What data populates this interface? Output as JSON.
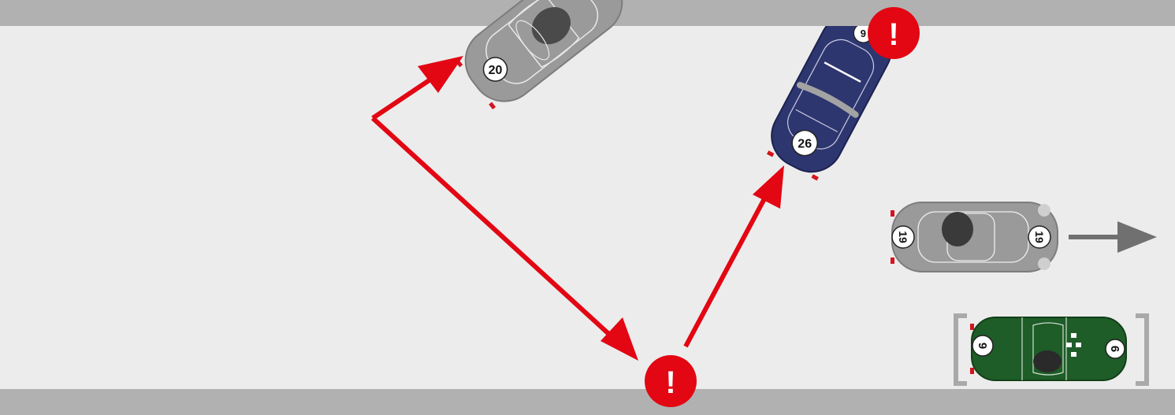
{
  "colors": {
    "track": "#ececec",
    "barrier": "#b1b1b1",
    "arrow_red": "#e30613",
    "arrow_grey": "#707070",
    "bracket": "#a9a9a9",
    "car_grey": "#9a9a9a",
    "car_grey_dark": "#4a4a4a",
    "car_blue": "#2e3670",
    "car_green": "#1e5c28",
    "lamp_red": "#d4141e"
  },
  "cars": [
    {
      "id": "car-20",
      "number": "20",
      "color": "grey",
      "flagged": false
    },
    {
      "id": "car-26",
      "number": "26",
      "rear_number": "9",
      "color": "blue",
      "flagged": true
    },
    {
      "id": "car-19",
      "number": "19",
      "rear_number": "19",
      "color": "grey",
      "direction": "right",
      "flagged": false
    },
    {
      "id": "car-9",
      "number": "9",
      "rear_number": "9",
      "color": "green",
      "bracketed": true,
      "flagged": false
    }
  ],
  "warnings": [
    {
      "id": "warning-bottom",
      "glyph": "!"
    },
    {
      "id": "warning-top",
      "glyph": "!"
    }
  ]
}
